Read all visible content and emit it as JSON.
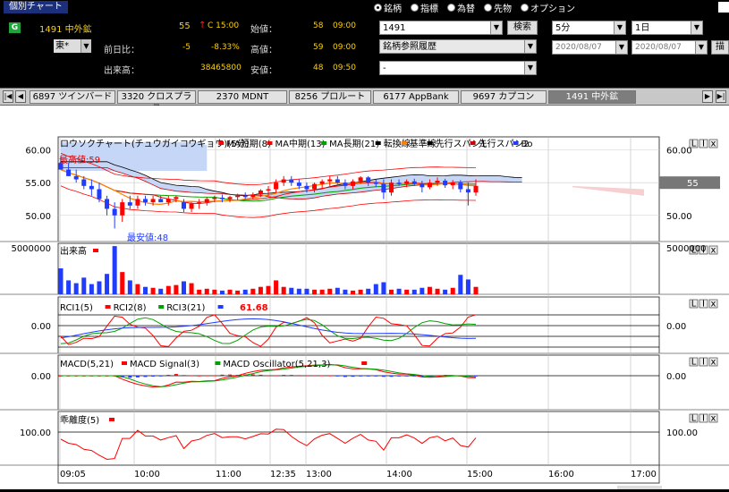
{
  "window": {
    "title": "個別チャート"
  },
  "radio_options": [
    {
      "label": "銘柄",
      "selected": true
    },
    {
      "label": "指標",
      "selected": false
    },
    {
      "label": "為替",
      "selected": false
    },
    {
      "label": "先物",
      "selected": false
    },
    {
      "label": "オプション",
      "selected": false
    }
  ],
  "quote": {
    "name": "1491 中外鉱",
    "price": "55",
    "change_arrow": "↑",
    "time": "C 15:00",
    "market": "東*",
    "prev_diff_label": "前日比：",
    "prev_diff": "-5",
    "prev_diff_pct": "-8.33%",
    "volume_label": "出来高：",
    "volume": "38465800",
    "open_label": "始値：",
    "open": "58",
    "open_time": "09:00",
    "high_label": "高値：",
    "high": "59",
    "high_time": "09:00",
    "low_label": "安値：",
    "low": "48",
    "low_time": "09:50"
  },
  "controls": {
    "code_value": "1491",
    "search_label": "検索",
    "ref_history": "銘柄参照履歴",
    "ref_value": "-",
    "interval": "5分",
    "period": "1日",
    "date_from": "2020/08/07",
    "date_to": "2020/08/07",
    "draw_label": "描画"
  },
  "tabs": [
    {
      "label": "6897 ツインバード",
      "active": false
    },
    {
      "label": "3320 クロスプラス",
      "active": false
    },
    {
      "label": "2370 MDNT",
      "active": false
    },
    {
      "label": "8256 プロルート",
      "active": false
    },
    {
      "label": "6177 AppBank",
      "active": false
    },
    {
      "label": "9697 カプコン",
      "active": false
    },
    {
      "label": "1491 中外鉱",
      "active": true
    }
  ],
  "colors": {
    "up": "#ff0000",
    "down": "#1f3cff",
    "ma_short": "#ff0000",
    "ma_mid": "#ff0000",
    "ma_long": "#00a000",
    "tenkan": "#000000",
    "kijun": "#ff8000",
    "span1": "#000000",
    "span2": "#cc0000",
    "cloud_blue": "#c6d6f6",
    "cloud_red": "#f6d0d0"
  },
  "chart_data": {
    "type": "candlestick",
    "price_panel": {
      "legend": [
        "ロウソクチャート(チュウガイコウギョウ)(5分)",
        "MA短期(8)",
        "MA中期(13)",
        "MA長期(21)",
        "転換線",
        "基準線",
        "先行スパン1",
        "先行スパン2",
        "Bo"
      ],
      "y_ticks": [
        "60.00",
        "55.00",
        "50.00"
      ],
      "y_range": [
        46,
        62
      ],
      "last_value": "55",
      "high_annotation": "最高値:59",
      "low_annotation": "最安値:48",
      "candles": [
        {
          "o": 58,
          "h": 59,
          "l": 57,
          "c": 57
        },
        {
          "o": 57,
          "h": 58,
          "l": 56,
          "c": 56
        },
        {
          "o": 56,
          "h": 57,
          "l": 55,
          "c": 55.5
        },
        {
          "o": 55.5,
          "h": 56,
          "l": 54,
          "c": 54.5
        },
        {
          "o": 54.5,
          "h": 55.5,
          "l": 53,
          "c": 54
        },
        {
          "o": 54,
          "h": 55,
          "l": 52,
          "c": 52.5
        },
        {
          "o": 52.5,
          "h": 53,
          "l": 50,
          "c": 51
        },
        {
          "o": 51,
          "h": 52,
          "l": 48,
          "c": 50
        },
        {
          "o": 50,
          "h": 52.5,
          "l": 49,
          "c": 52
        },
        {
          "o": 52,
          "h": 53,
          "l": 51,
          "c": 51.5
        },
        {
          "o": 51.5,
          "h": 53,
          "l": 51,
          "c": 52.5
        },
        {
          "o": 52.5,
          "h": 53,
          "l": 51.5,
          "c": 52
        },
        {
          "o": 52,
          "h": 53,
          "l": 51.5,
          "c": 52.5
        },
        {
          "o": 52.5,
          "h": 53,
          "l": 52,
          "c": 52
        },
        {
          "o": 52,
          "h": 53,
          "l": 51.5,
          "c": 52.5
        },
        {
          "o": 52.5,
          "h": 53,
          "l": 52,
          "c": 52.8
        },
        {
          "o": 52,
          "h": 52.5,
          "l": 50.5,
          "c": 51
        },
        {
          "o": 51,
          "h": 52,
          "l": 50.5,
          "c": 51.8
        },
        {
          "o": 51.8,
          "h": 52.5,
          "l": 51,
          "c": 52
        },
        {
          "o": 52,
          "h": 52.8,
          "l": 51.5,
          "c": 52.5
        },
        {
          "o": 52.5,
          "h": 53,
          "l": 52,
          "c": 52.7
        },
        {
          "o": 52.7,
          "h": 53.2,
          "l": 52,
          "c": 52.5
        },
        {
          "o": 52.5,
          "h": 53,
          "l": 52,
          "c": 52.8
        },
        {
          "o": 52.8,
          "h": 53.3,
          "l": 52.3,
          "c": 53
        },
        {
          "o": 53,
          "h": 53.5,
          "l": 52.5,
          "c": 52.8
        },
        {
          "o": 52.8,
          "h": 53.5,
          "l": 52.5,
          "c": 53.2
        },
        {
          "o": 53.2,
          "h": 54,
          "l": 52.8,
          "c": 53.8
        },
        {
          "o": 53.8,
          "h": 54.5,
          "l": 53,
          "c": 54
        },
        {
          "o": 54,
          "h": 55.5,
          "l": 53.5,
          "c": 55
        },
        {
          "o": 55,
          "h": 56,
          "l": 54.5,
          "c": 55.5
        },
        {
          "o": 55.5,
          "h": 56,
          "l": 54.5,
          "c": 55
        },
        {
          "o": 55,
          "h": 55.5,
          "l": 54,
          "c": 54.5
        },
        {
          "o": 54.5,
          "h": 55,
          "l": 53.5,
          "c": 54
        },
        {
          "o": 54,
          "h": 55,
          "l": 53.5,
          "c": 54.8
        },
        {
          "o": 54.8,
          "h": 55.5,
          "l": 54,
          "c": 55.2
        },
        {
          "o": 55.2,
          "h": 56,
          "l": 54.5,
          "c": 55.5
        },
        {
          "o": 55.5,
          "h": 56,
          "l": 54.8,
          "c": 55
        },
        {
          "o": 55,
          "h": 55.5,
          "l": 54,
          "c": 54.5
        },
        {
          "o": 54.5,
          "h": 55.5,
          "l": 54,
          "c": 55.2
        },
        {
          "o": 55.2,
          "h": 56,
          "l": 54.8,
          "c": 55.8
        },
        {
          "o": 55.8,
          "h": 56,
          "l": 54.5,
          "c": 55
        },
        {
          "o": 55,
          "h": 55.5,
          "l": 54.3,
          "c": 54.8
        },
        {
          "o": 54.8,
          "h": 55.5,
          "l": 52.5,
          "c": 53.5
        },
        {
          "o": 53.5,
          "h": 55.5,
          "l": 53,
          "c": 55
        },
        {
          "o": 55,
          "h": 55.5,
          "l": 54.5,
          "c": 54.8
        },
        {
          "o": 54.8,
          "h": 55.5,
          "l": 54.3,
          "c": 55.2
        },
        {
          "o": 55.2,
          "h": 55.6,
          "l": 54.5,
          "c": 54.8
        },
        {
          "o": 54.8,
          "h": 55.3,
          "l": 53.5,
          "c": 54.3
        },
        {
          "o": 54.3,
          "h": 55.5,
          "l": 54,
          "c": 55
        },
        {
          "o": 55,
          "h": 55.8,
          "l": 54.5,
          "c": 55.3
        },
        {
          "o": 55.3,
          "h": 55.6,
          "l": 54.2,
          "c": 54.6
        },
        {
          "o": 54.6,
          "h": 55.4,
          "l": 54,
          "c": 55
        },
        {
          "o": 55,
          "h": 55.4,
          "l": 53.5,
          "c": 54
        },
        {
          "o": 54,
          "h": 55,
          "l": 51.5,
          "c": 53.5
        },
        {
          "o": 53.5,
          "h": 55.5,
          "l": 53,
          "c": 54.5
        }
      ]
    },
    "volume_panel": {
      "legend": [
        "出来高"
      ],
      "y_ticks": [
        "5000000"
      ],
      "y_range": [
        0,
        5500000
      ],
      "values": [
        2800000,
        1500000,
        1200000,
        1800000,
        1100000,
        1400000,
        2200000,
        5200000,
        2400000,
        1500000,
        1100000,
        800000,
        700000,
        600000,
        900000,
        1000000,
        1400000,
        1200000,
        500000,
        600000,
        500000,
        400000,
        500000,
        400000,
        500000,
        600000,
        800000,
        900000,
        1500000,
        800000,
        700000,
        600000,
        600000,
        500000,
        500000,
        600000,
        700000,
        500000,
        400000,
        500000,
        600000,
        1100000,
        1300000,
        500000,
        600000,
        500000,
        500000,
        700000,
        800000,
        600000,
        500000,
        700000,
        2100000,
        1600000,
        800000
      ]
    },
    "rci_panel": {
      "legend": [
        "RCI1(5)",
        "RCI2(8)",
        "RCI3(21)"
      ],
      "current": "61.68",
      "y_ticks": [
        "0.00"
      ]
    },
    "macd_panel": {
      "legend": [
        "MACD(5,21)",
        "MACD Signal(3)",
        "MACD Oscillator(5,21,3)"
      ],
      "y_ticks": [
        "0.00"
      ]
    },
    "kairi_panel": {
      "legend": [
        "乖離度(5)"
      ],
      "y_ticks": [
        "100.00"
      ]
    },
    "x_labels": [
      "09:05",
      "10:00",
      "11:00",
      "12:35",
      "13:00",
      "14:00",
      "15:00",
      "16:00",
      "17:00"
    ]
  }
}
